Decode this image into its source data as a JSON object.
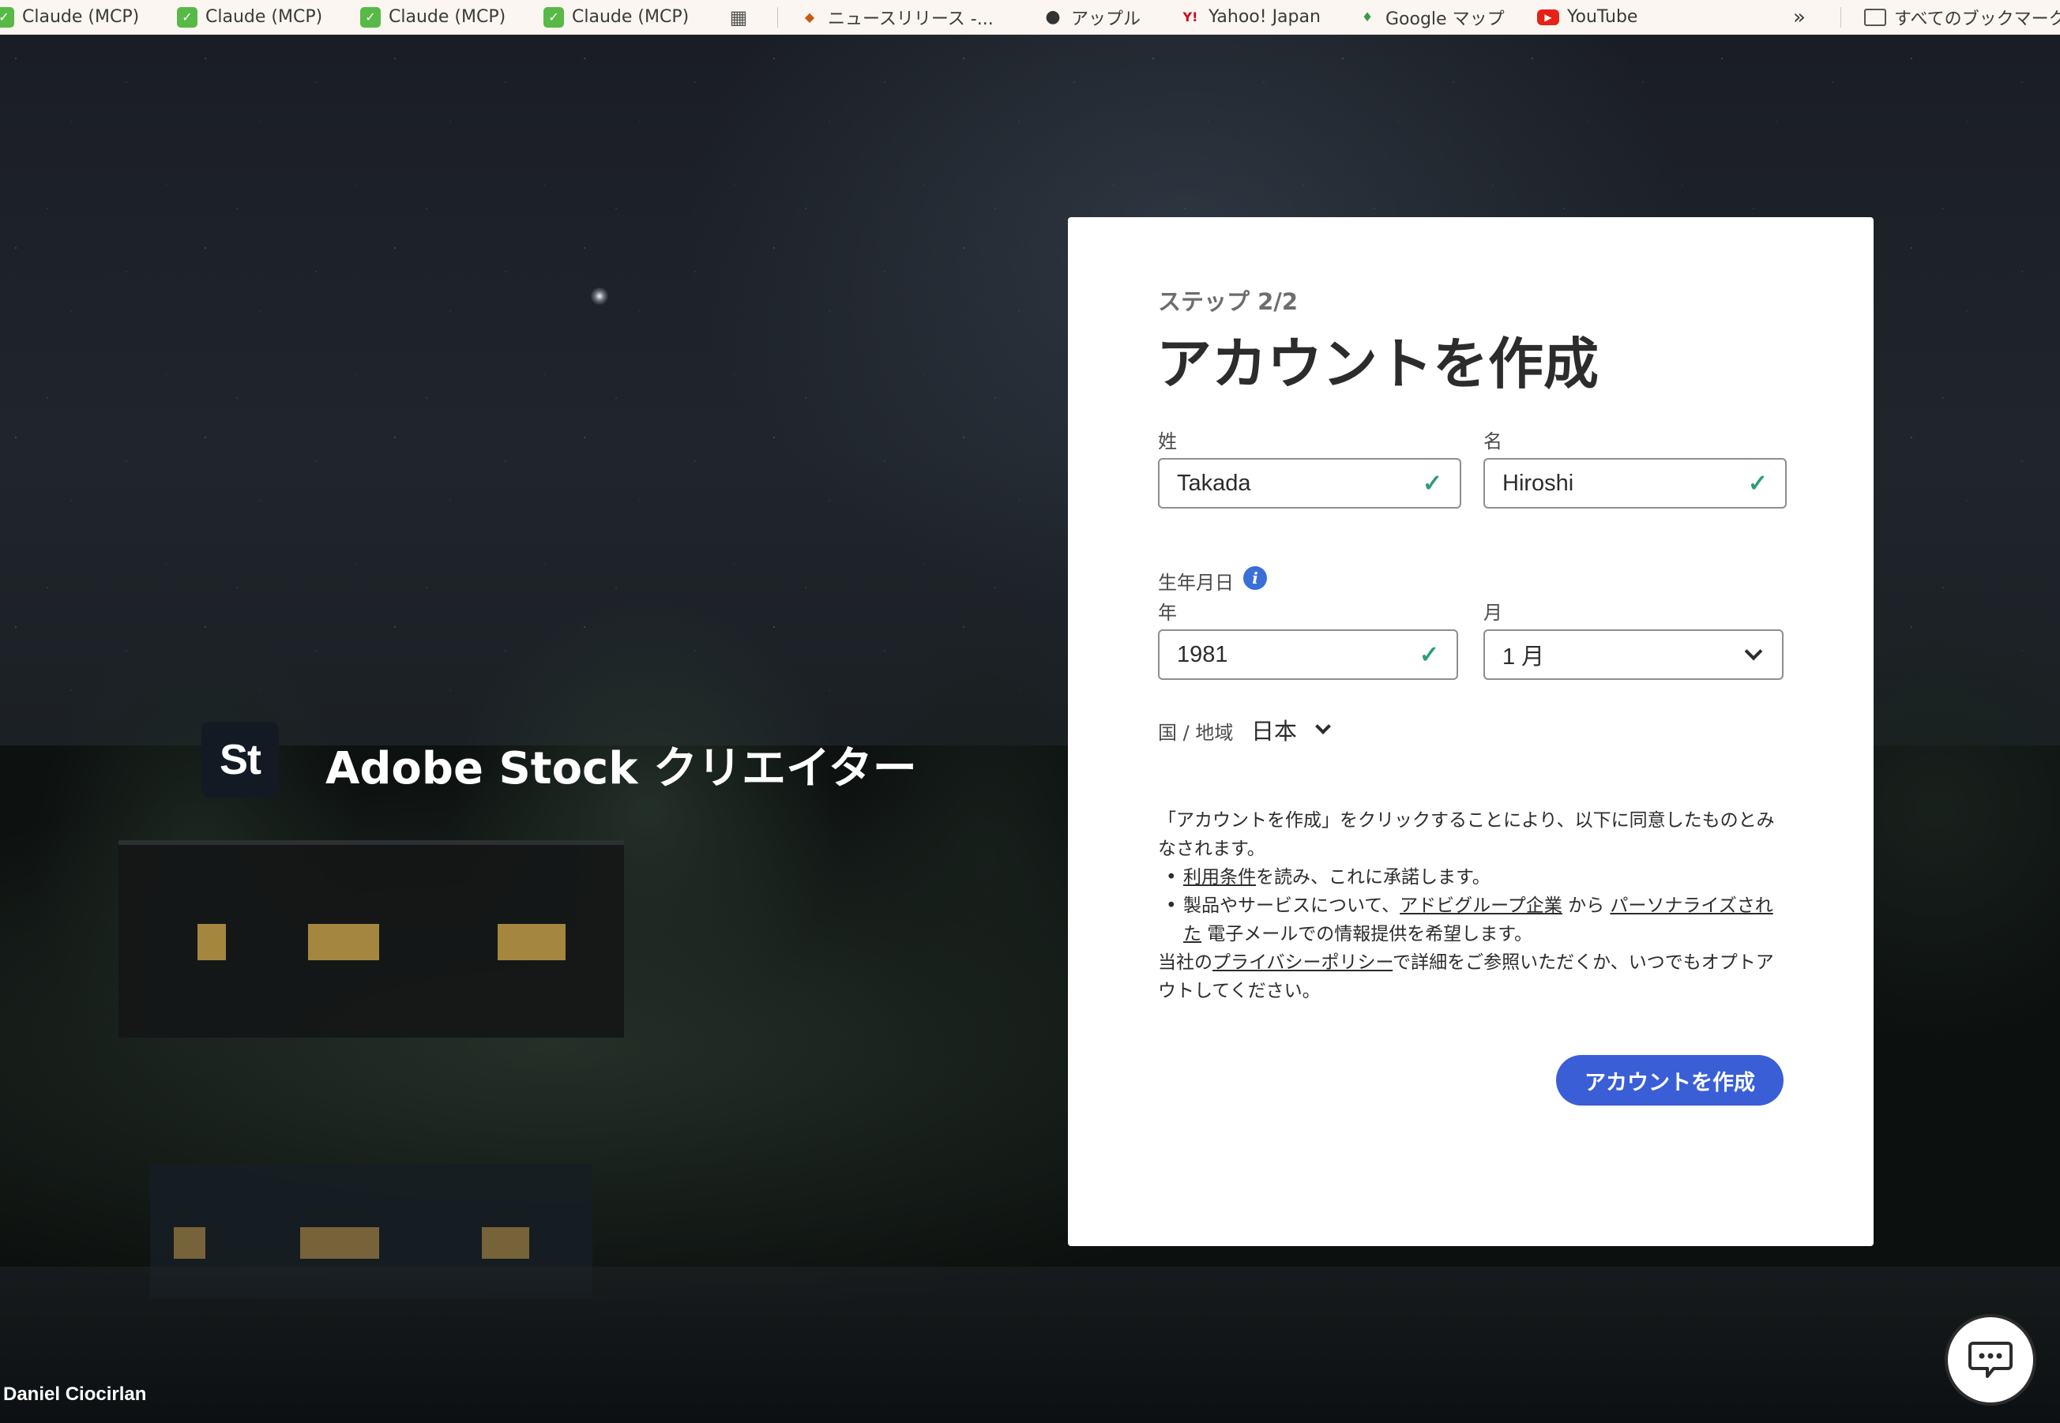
{
  "bookmarks": {
    "items": [
      {
        "label": "Claude (MCP)",
        "icon": "green-check-icon"
      },
      {
        "label": "Claude (MCP)",
        "icon": "green-check-icon"
      },
      {
        "label": "Claude (MCP)",
        "icon": "green-check-icon"
      },
      {
        "label": "Claude (MCP)",
        "icon": "green-check-icon"
      },
      {
        "label": "",
        "icon": "apps-grid-icon"
      },
      {
        "label": "ニュースリリース -...",
        "icon": "news-icon"
      },
      {
        "label": "アップル",
        "icon": "apple-icon"
      },
      {
        "label": "Yahoo! Japan",
        "icon": "yahoo-icon"
      },
      {
        "label": "Google マップ",
        "icon": "maps-pin-icon"
      },
      {
        "label": "YouTube",
        "icon": "youtube-icon"
      }
    ],
    "overflow": "»",
    "all_bookmarks": "すべてのブックマーク"
  },
  "brand": {
    "logo_text": "St",
    "title": "Adobe Stock クリエイター"
  },
  "photo_credit": "Daniel Ciocirlan",
  "form": {
    "step": "ステップ 2/2",
    "title": "アカウントを作成",
    "last_name": {
      "label": "姓",
      "value": "Takada"
    },
    "first_name": {
      "label": "名",
      "value": "Hiroshi"
    },
    "birthdate_label": "生年月日",
    "year": {
      "label": "年",
      "value": "1981"
    },
    "month": {
      "label": "月",
      "value": "1 月"
    },
    "country": {
      "label": "国 / 地域",
      "value": "日本"
    },
    "check_mark": "✓",
    "legal": {
      "intro": "「アカウントを作成」をクリックすることにより、以下に同意したものとみなされます。",
      "bullet1_link": "利用条件",
      "bullet1_text": "を読み、これに承諾します。",
      "bullet2_pre": "製品やサービスについて、",
      "bullet2_link1": "アドビグループ企業",
      "bullet2_mid": " から ",
      "bullet2_link2": "パーソナライズされた",
      "bullet2_post": " 電子メールでの情報提供を希望します。",
      "privacy_pre": "当社の",
      "privacy_link": "プライバシーポリシー",
      "privacy_post": "で詳細をご参照いただくか、いつでもオプトアウトしてください。"
    },
    "submit_label": "アカウントを作成"
  },
  "colors": {
    "primary_button": "#3a5ed6",
    "valid_check": "#2d9d78",
    "info_icon": "#3b6fd8"
  }
}
